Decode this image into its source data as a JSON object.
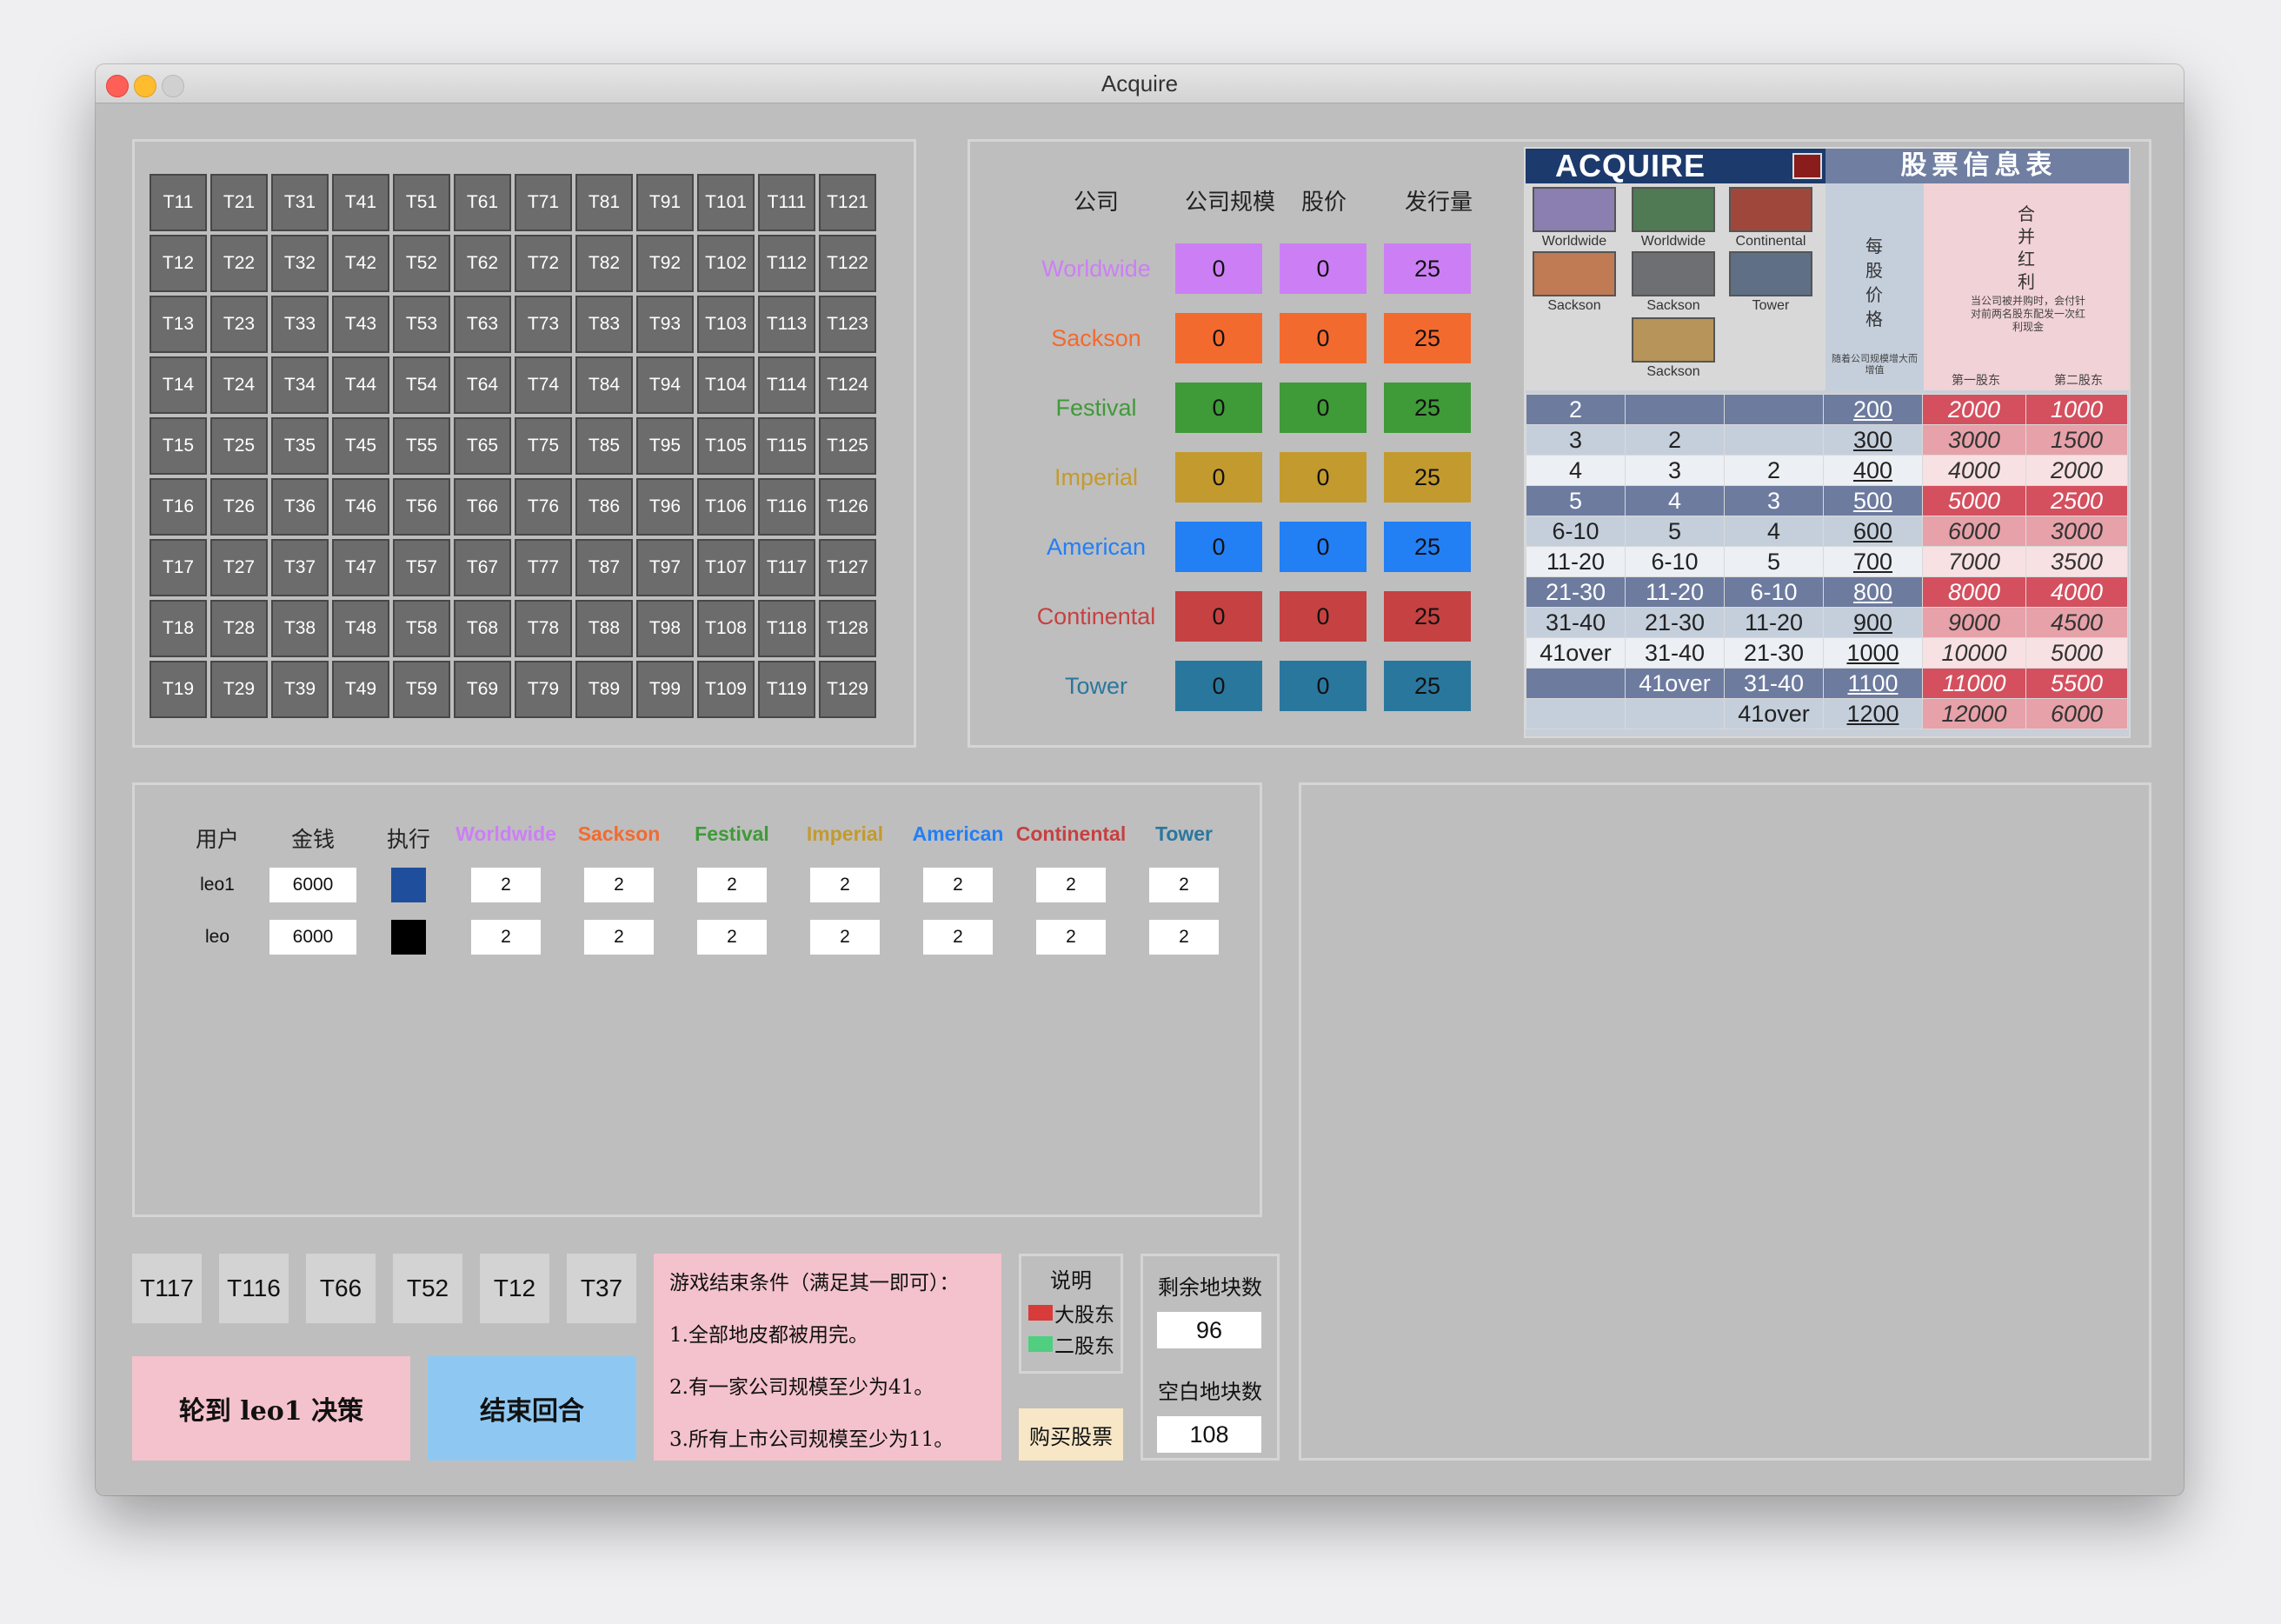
{
  "window": {
    "title": "Acquire"
  },
  "colors": {
    "worldwide": "#cc7ff5",
    "sackson": "#f36a2f",
    "festival": "#3f9a38",
    "imperial": "#c39a2e",
    "american": "#237ff4",
    "continental": "#c64141",
    "tower": "#2a779e"
  },
  "tiles": [
    [
      "T11",
      "T21",
      "T31",
      "T41",
      "T51",
      "T61",
      "T71",
      "T81",
      "T91",
      "T101",
      "T111",
      "T121"
    ],
    [
      "T12",
      "T22",
      "T32",
      "T42",
      "T52",
      "T62",
      "T72",
      "T82",
      "T92",
      "T102",
      "T112",
      "T122"
    ],
    [
      "T13",
      "T23",
      "T33",
      "T43",
      "T53",
      "T63",
      "T73",
      "T83",
      "T93",
      "T103",
      "T113",
      "T123"
    ],
    [
      "T14",
      "T24",
      "T34",
      "T44",
      "T54",
      "T64",
      "T74",
      "T84",
      "T94",
      "T104",
      "T114",
      "T124"
    ],
    [
      "T15",
      "T25",
      "T35",
      "T45",
      "T55",
      "T65",
      "T75",
      "T85",
      "T95",
      "T105",
      "T115",
      "T125"
    ],
    [
      "T16",
      "T26",
      "T36",
      "T46",
      "T56",
      "T66",
      "T76",
      "T86",
      "T96",
      "T106",
      "T116",
      "T126"
    ],
    [
      "T17",
      "T27",
      "T37",
      "T47",
      "T57",
      "T67",
      "T77",
      "T87",
      "T97",
      "T107",
      "T117",
      "T127"
    ],
    [
      "T18",
      "T28",
      "T38",
      "T48",
      "T58",
      "T68",
      "T78",
      "T88",
      "T98",
      "T108",
      "T118",
      "T128"
    ],
    [
      "T19",
      "T29",
      "T39",
      "T49",
      "T59",
      "T69",
      "T79",
      "T89",
      "T99",
      "T109",
      "T119",
      "T129"
    ]
  ],
  "companies": {
    "headers": [
      "公司",
      "公司规模",
      "股价",
      "发行量"
    ],
    "rows": [
      {
        "name": "Worldwide",
        "size": "0",
        "price": "0",
        "issued": "25"
      },
      {
        "name": "Sackson",
        "size": "0",
        "price": "0",
        "issued": "25"
      },
      {
        "name": "Festival",
        "size": "0",
        "price": "0",
        "issued": "25"
      },
      {
        "name": "Imperial",
        "size": "0",
        "price": "0",
        "issued": "25"
      },
      {
        "name": "American",
        "size": "0",
        "price": "0",
        "issued": "25"
      },
      {
        "name": "Continental",
        "size": "0",
        "price": "0",
        "issued": "25"
      },
      {
        "name": "Tower",
        "size": "0",
        "price": "0",
        "issued": "25"
      }
    ]
  },
  "stock_chart": {
    "logo": "ACQUIRE",
    "title": "股票信息表",
    "cert_labels": [
      "Worldwide",
      "Worldwide",
      "Continental",
      "Sackson",
      "Sackson",
      "Tower",
      "Sackson"
    ],
    "per_share_price_label": "每股价格",
    "per_share_note": "随着公司规模增大而增值",
    "merger_bonus_label": "合并红利",
    "merger_note": "当公司被并购时，会付针对前两名股东配发一次红利现金",
    "first_holder": "第一股东",
    "second_holder": "第二股东",
    "rows": [
      [
        "2",
        "",
        "",
        "200",
        "2000",
        "1000"
      ],
      [
        "3",
        "2",
        "",
        "300",
        "3000",
        "1500"
      ],
      [
        "4",
        "3",
        "2",
        "400",
        "4000",
        "2000"
      ],
      [
        "5",
        "4",
        "3",
        "500",
        "5000",
        "2500"
      ],
      [
        "6-10",
        "5",
        "4",
        "600",
        "6000",
        "3000"
      ],
      [
        "11-20",
        "6-10",
        "5",
        "700",
        "7000",
        "3500"
      ],
      [
        "21-30",
        "11-20",
        "6-10",
        "800",
        "8000",
        "4000"
      ],
      [
        "31-40",
        "21-30",
        "11-20",
        "900",
        "9000",
        "4500"
      ],
      [
        "41over",
        "31-40",
        "21-30",
        "1000",
        "10000",
        "5000"
      ],
      [
        "",
        "41over",
        "31-40",
        "1100",
        "11000",
        "5500"
      ],
      [
        "",
        "",
        "41over",
        "1200",
        "12000",
        "6000"
      ]
    ]
  },
  "players": {
    "headers": [
      "用户",
      "金钱",
      "执行",
      "Worldwide",
      "Sackson",
      "Festival",
      "Imperial",
      "American",
      "Continental",
      "Tower"
    ],
    "rows": [
      {
        "name": "leo1",
        "money": "6000",
        "exec_color": "#1f4f9c",
        "shares": [
          "2",
          "2",
          "2",
          "2",
          "2",
          "2",
          "2"
        ]
      },
      {
        "name": "leo",
        "money": "6000",
        "exec_color": "#000000",
        "shares": [
          "2",
          "2",
          "2",
          "2",
          "2",
          "2",
          "2"
        ]
      }
    ]
  },
  "hand_tiles": [
    "T117",
    "T116",
    "T66",
    "T52",
    "T12",
    "T37"
  ],
  "turn_button": "轮到 leo1 决策",
  "end_turn_button": "结束回合",
  "end_conditions": {
    "title": "游戏结束条件（满足其一即可）：",
    "items": [
      "1.全部地皮都被用完。",
      "2.有一家公司规模至少为41。",
      "3.所有上市公司规模至少为11。"
    ]
  },
  "legend": {
    "title": "说明",
    "major": "大股东",
    "minor": "二股东",
    "major_color": "#d93a3a",
    "minor_color": "#4fcf7f"
  },
  "buy_stock_button": "购买股票",
  "remaining_tiles": {
    "label": "剩余地块数",
    "value": "96"
  },
  "empty_tiles": {
    "label": "空白地块数",
    "value": "108"
  }
}
